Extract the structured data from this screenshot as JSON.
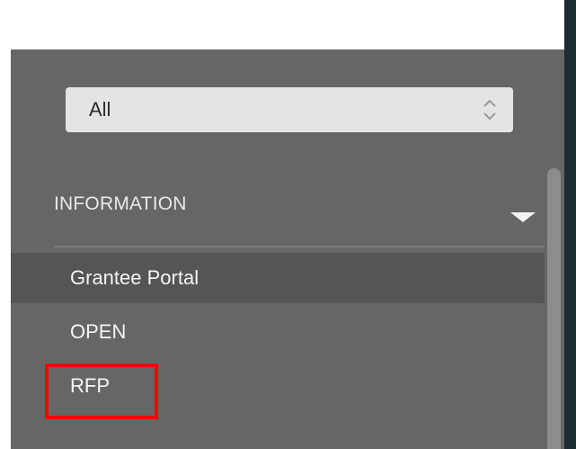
{
  "filter": {
    "selected_value": "All",
    "arrows_icon": "up-down-chevron-icon"
  },
  "section": {
    "title": "INFORMATION",
    "toggle_icon": "caret-down-icon"
  },
  "items": [
    {
      "label": "Grantee Portal",
      "active": true
    },
    {
      "label": "OPEN",
      "active": false
    },
    {
      "label": "RFP",
      "active": false,
      "highlighted": true
    }
  ],
  "colors": {
    "panel_bg": "#666666",
    "active_row_bg": "#555555",
    "highlight": "#ff0000",
    "right_edge": "#1c2d2f"
  }
}
